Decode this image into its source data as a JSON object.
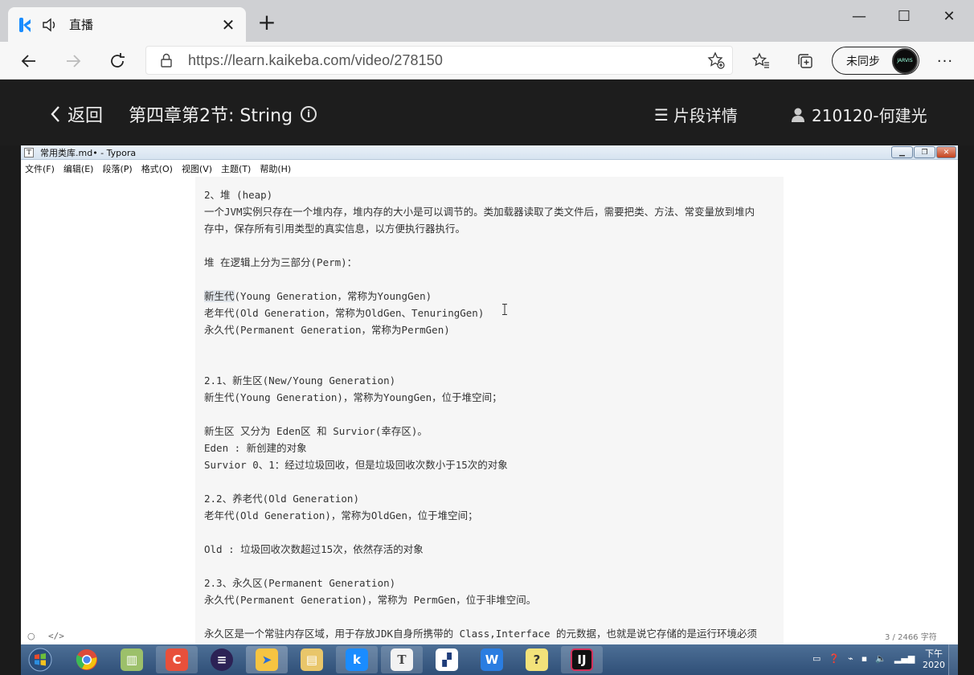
{
  "browser": {
    "tab_title": "直播",
    "url": "https://learn.kaikeba.com/video/278150",
    "profile_label": "未同步",
    "profile_avatar_text": "JARVIS"
  },
  "site": {
    "back_label": "返回",
    "lesson_title": "第四章第2节:  String",
    "segments_label": "片段详情",
    "user_label": "210120-何建光"
  },
  "typora": {
    "window_title": "常用类库.md• - Typora",
    "menu": [
      "文件(F)",
      "编辑(E)",
      "段落(P)",
      "格式(O)",
      "视图(V)",
      "主题(T)",
      "帮助(H)"
    ],
    "lines": [
      "2、堆 (heap)",
      "一个JVM实例只存在一个堆内存，堆内存的大小是可以调节的。类加载器读取了类文件后，需要把类、方法、常变量放到堆内",
      "存中，保存所有引用类型的真实信息，以方便执行器执行。",
      "",
      "堆 在逻辑上分为三部分(Perm)：",
      "",
      "新生代(Young Generation，常称为YoungGen)",
      "老年代(Old Generation，常称为OldGen、TenuringGen)",
      "永久代(Permanent Generation，常称为PermGen)",
      "",
      "",
      "2.1、新生区(New/Young Generation)",
      "新生代(Young Generation)，常称为YoungGen，位于堆空间；",
      "",
      "新生区 又分为 Eden区 和 Survior(幸存区)。",
      "Eden : 新创建的对象",
      "Survior 0、1：经过垃圾回收，但是垃圾回收次数小于15次的对象",
      "",
      "2.2、养老代(Old Generation)",
      "老年代(Old Generation)，常称为OldGen，位于堆空间；",
      "",
      "Old : 垃圾回收次数超过15次，依然存活的对象",
      "",
      "2.3、永久区(Permanent Generation)",
      "永久代(Permanent Generation)，常称为 PermGen，位于非堆空间。",
      "",
      "永久区是一个常驻内存区域，用于存放JDK自身所携带的 Class,Interface 的元数据，也就是说它存储的是运行环境必须"
    ],
    "selected_prefix": "新生代",
    "selected_rest": "(Young Generation，常称为YoungGen)",
    "footer_left_icon": "○",
    "footer_code_icon": "</>",
    "word_count": "3 / 2466 字符"
  },
  "taskbar": {
    "clock_period": "下午",
    "clock_year": "2020"
  },
  "colors": {
    "site_header_bg": "#1d1d1d",
    "editor_bg": "#f6f6f6",
    "taskbar_bg": "#3b5d86"
  }
}
